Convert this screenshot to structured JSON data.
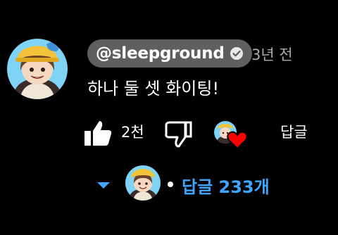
{
  "comment": {
    "author": "@sleepground",
    "time": "3년 전",
    "text": "하나 둘 셋 화이팅!",
    "likes": "2천",
    "reply_label": "답글",
    "replies_label": "답글 233개"
  },
  "colors": {
    "background": "#000000",
    "chip": "#5f5f5f",
    "link": "#3ea6ff",
    "heart": "#ff0000"
  },
  "icons": [
    "avatar",
    "verified-icon",
    "like-icon",
    "dislike-icon",
    "creator-heart-icon",
    "chevron-down-icon"
  ]
}
